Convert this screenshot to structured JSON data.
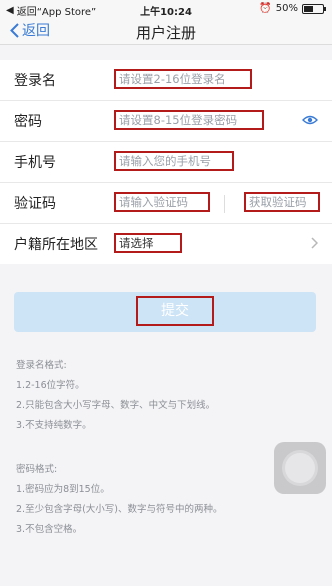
{
  "status_bar": {
    "back_app": "返回“App Store”",
    "time": "上午10:24",
    "battery": "50%",
    "battery_level": 0.5
  },
  "navbar": {
    "back_label": "返回",
    "title": "用户注册"
  },
  "form": {
    "username": {
      "label": "登录名",
      "placeholder": "请设置2-16位登录名"
    },
    "password": {
      "label": "密码",
      "placeholder": "请设置8-15位登录密码"
    },
    "phone": {
      "label": "手机号",
      "placeholder": "请输入您的手机号"
    },
    "code": {
      "label": "验证码",
      "placeholder": "请输入验证码",
      "get_code": "获取验证码"
    },
    "region": {
      "label": "户籍所在地区",
      "value": "请选择"
    }
  },
  "submit_label": "提交",
  "username_rules": {
    "title": "登录名格式:",
    "items": [
      "1.2-16位字符。",
      "2.只能包含大小写字母、数字、中文与下划线。",
      "3.不支持纯数字。"
    ]
  },
  "password_rules": {
    "title": "密码格式:",
    "items": [
      "1.密码应为8到15位。",
      "2.至少包含字母(大小写)、数字与符号中的两种。",
      "3.不包含空格。"
    ]
  },
  "icons": {
    "back": "chevron-left-icon",
    "eye": "eye-icon",
    "region_arrow": "chevron-right-icon",
    "assistive_touch": "assistive-touch-icon"
  },
  "colors": {
    "accent": "#3a7bd5",
    "annotation": "#b31a1a",
    "submit_bg": "#cde4f7"
  }
}
